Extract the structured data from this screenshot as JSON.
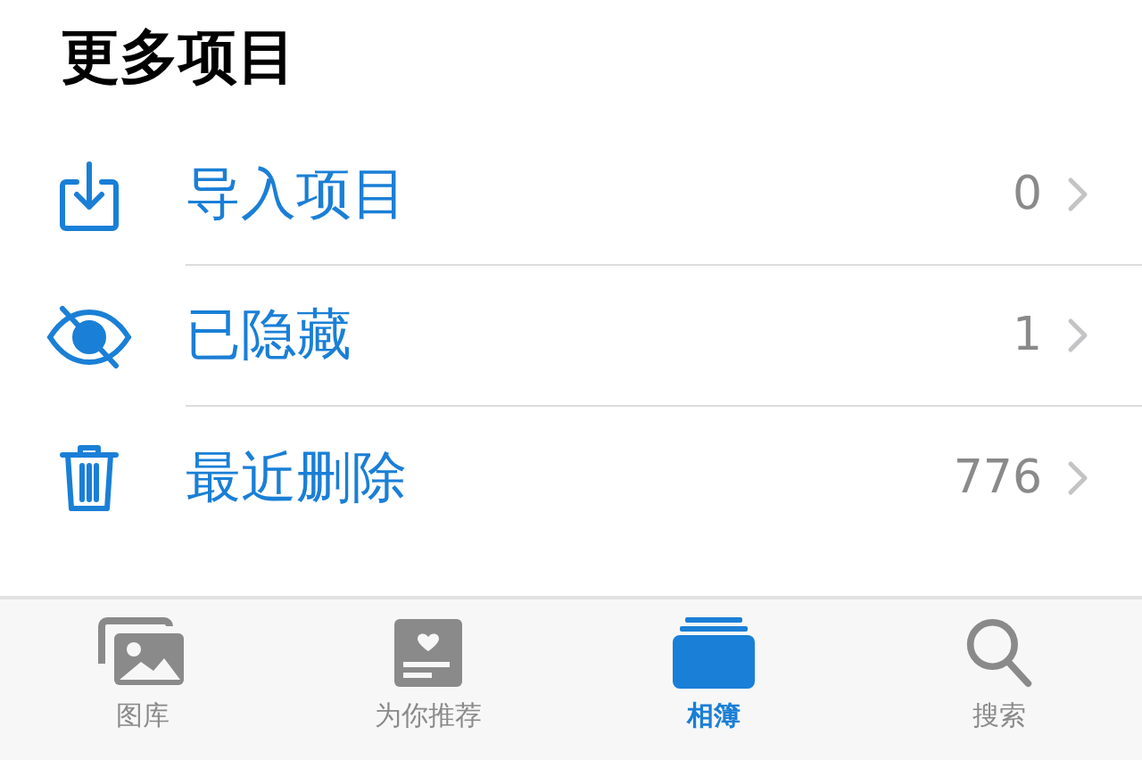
{
  "section_title": "更多项目",
  "items": [
    {
      "kind": "import",
      "label": "导入项目",
      "count": "0"
    },
    {
      "kind": "hidden",
      "label": "已隐藏",
      "count": "1"
    },
    {
      "kind": "trash",
      "label": "最近删除",
      "count": "776"
    }
  ],
  "tab_bar": [
    {
      "kind": "library",
      "label": "图库",
      "selected": false
    },
    {
      "kind": "foryou",
      "label": "为你推荐",
      "selected": false
    },
    {
      "kind": "albums",
      "label": "相簿",
      "selected": true
    },
    {
      "kind": "search",
      "label": "搜索",
      "selected": false
    }
  ]
}
